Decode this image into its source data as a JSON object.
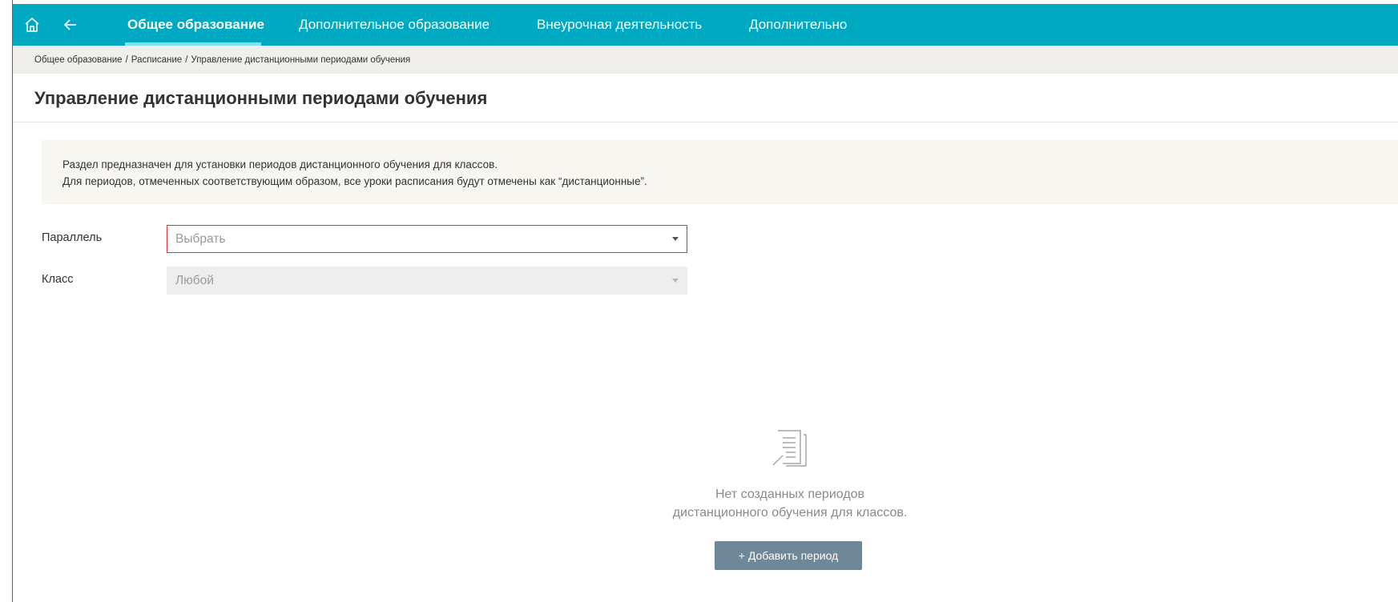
{
  "nav": {
    "tabs": [
      {
        "label": "Общее образование",
        "active": true
      },
      {
        "label": "Дополнительное образование",
        "active": false
      },
      {
        "label": "Внеурочная деятельность",
        "active": false
      },
      {
        "label": "Дополнительно",
        "active": false
      }
    ],
    "icons": [
      "home-icon",
      "back-arrow-icon"
    ]
  },
  "breadcrumb": {
    "items": [
      "Общее образование",
      "Расписание",
      "Управление дистанционными периодами обучения"
    ],
    "separator": "/"
  },
  "page": {
    "title": "Управление дистанционными периодами обучения"
  },
  "info": {
    "line1": "Раздел предназначен для установки периодов дистанционного обучения для классов.",
    "line2": "Для периодов, отмеченных соответствующим образом, все уроки расписания будут отмечены как “дистанционные”."
  },
  "form": {
    "parallel": {
      "label": "Параллель",
      "value": "",
      "placeholder": "Выбрать",
      "state": "error"
    },
    "class": {
      "label": "Класс",
      "value": "Любой",
      "state": "disabled"
    }
  },
  "empty": {
    "icon": "document-list-icon",
    "line1": "Нет созданных периодов",
    "line2": "дистанционного обучения для классов.",
    "button_label": "+ Добавить период"
  },
  "colors": {
    "nav_bg": "#00a9c2",
    "breadcrumb_bg": "#f1efeb",
    "info_bg": "#f8f6f1",
    "error_border": "#e2323c",
    "button_bg": "#6f8898"
  }
}
